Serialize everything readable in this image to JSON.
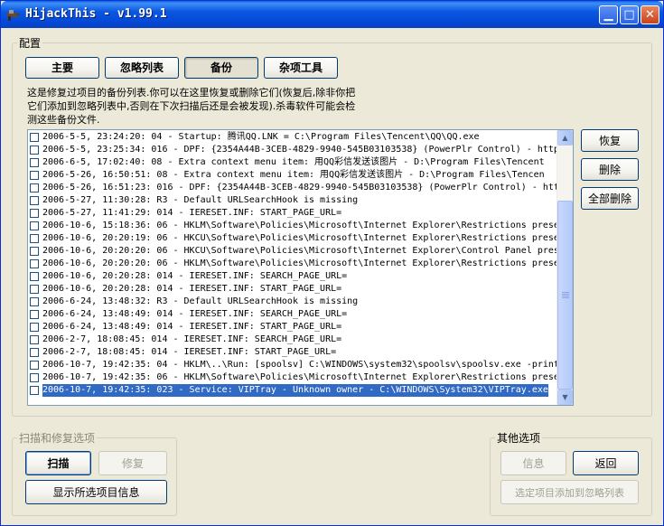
{
  "window": {
    "title": "HijackThis - v1.99.1",
    "app_icon": "hijackthis-icon"
  },
  "config": {
    "legend": "配置",
    "tabs": [
      "主要",
      "忽略列表",
      "备份",
      "杂项工具"
    ],
    "active_tab": "备份",
    "description": "这是修复过项目的备份列表.你可以在这里恢复或删除它们(恢复后,除非你把它们添加到忽略列表中,否则在下次扫描后还是会被发现).杀毒软件可能会检测这些备份文件.",
    "actions": {
      "restore": "恢复",
      "delete": "删除",
      "delete_all": "全部删除"
    }
  },
  "backup_list": {
    "selected_index": 20,
    "items": [
      "2006-5-5, 23:24:20: 04 - Startup: 腾讯QQ.LNK = C:\\Program Files\\Tencent\\QQ\\QQ.exe",
      "2006-5-5, 23:25:34: 016 - DPF: {2354A44B-3CEB-4829-9940-545B03103538} (PowerPlr Control) - http",
      "2006-6-5, 17:02:40: 08 - Extra context menu item: 用QQ彩信发送该图片 - D:\\Program Files\\Tencent",
      "2006-5-26, 16:50:51: 08 - Extra context menu item: 用QQ彩信发送该图片 - D:\\Program Files\\Tencen",
      "2006-5-26, 16:51:23: 016 - DPF: {2354A44B-3CEB-4829-9940-545B03103538} (PowerPlr Control) - htt",
      "2006-5-27, 11:30:28: R3 - Default URLSearchHook is missing",
      "2006-5-27, 11:41:29: 014 - IERESET.INF: START_PAGE_URL=",
      "2006-10-6, 15:18:36: 06 - HKLM\\Software\\Policies\\Microsoft\\Internet Explorer\\Restrictions prese",
      "2006-10-6, 20:20:19: 06 - HKCU\\Software\\Policies\\Microsoft\\Internet Explorer\\Restrictions prese",
      "2006-10-6, 20:20:20: 06 - HKCU\\Software\\Policies\\Microsoft\\Internet Explorer\\Control Panel pres",
      "2006-10-6, 20:20:20: 06 - HKLM\\Software\\Policies\\Microsoft\\Internet Explorer\\Restrictions prese",
      "2006-10-6, 20:20:28: 014 - IERESET.INF: SEARCH_PAGE_URL=",
      "2006-10-6, 20:20:28: 014 - IERESET.INF: START_PAGE_URL=",
      "2006-6-24, 13:48:32: R3 - Default URLSearchHook is missing",
      "2006-6-24, 13:48:49: 014 - IERESET.INF: SEARCH_PAGE_URL=",
      "2006-6-24, 13:48:49: 014 - IERESET.INF: START_PAGE_URL=",
      "2006-2-7, 18:08:45: 014 - IERESET.INF: SEARCH_PAGE_URL=",
      "2006-2-7, 18:08:45: 014 - IERESET.INF: START_PAGE_URL=",
      "2006-10-7, 19:42:35: 04 - HKLM\\..\\Run: [spoolsv] C:\\WINDOWS\\system32\\spoolsv\\spoolsv.exe -print",
      "2006-10-7, 19:42:35: 06 - HKLM\\Software\\Policies\\Microsoft\\Internet Explorer\\Restrictions prese",
      "2006-10-7, 19:42:35: 023 - Service: VIPTray - Unknown owner - C:\\WINDOWS\\System32\\VIPTray.exe"
    ]
  },
  "scan_group": {
    "legend": "扫描和修复选项",
    "scan": "扫描",
    "fix": "修复",
    "show_info": "显示所选项目信息"
  },
  "other_group": {
    "legend": "其他选项",
    "info": "信息",
    "back": "返回",
    "add_ignore": "选定项目添加到忽略列表"
  }
}
